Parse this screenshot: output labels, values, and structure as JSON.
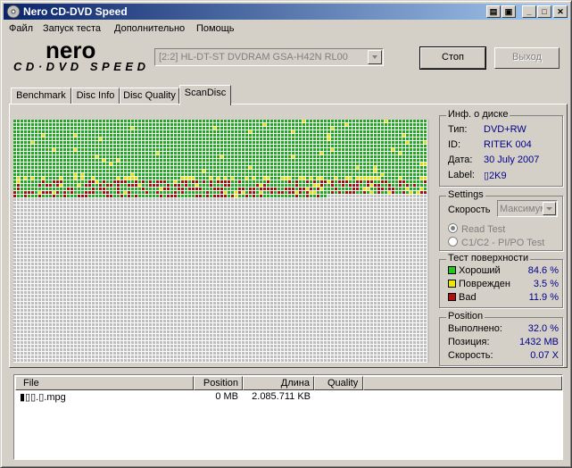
{
  "window": {
    "title": "Nero CD-DVD Speed",
    "controls": [
      "book-icon",
      "save-icon",
      "minimize",
      "maximize",
      "close"
    ],
    "title_color_start": "#0a246a",
    "title_color_end": "#a6caf0"
  },
  "menu": [
    "Файл",
    "Запуск теста",
    "Дополнительно",
    "Помощь"
  ],
  "logo": {
    "brand": "nero",
    "product": "CD·DVD SPEED"
  },
  "drive": {
    "selected": "[2:2]  HL-DT-ST DVDRAM GSA-H42N RL00"
  },
  "buttons": {
    "stop": "Стоп",
    "exit": "Выход"
  },
  "tabs": [
    "Benchmark",
    "Disc Info",
    "Disc Quality",
    "ScanDisc"
  ],
  "active_tab": "ScanDisc",
  "scan_map": {
    "colors": {
      "good": "#22a822",
      "damaged": "#e0e000",
      "bad": "#a01010",
      "empty": "#bfbfbf",
      "grid": "#ffffff"
    },
    "scanned_percent": 32.0
  },
  "disc_info": {
    "title": "Инф. о диске",
    "type_label": "Тип:",
    "type_value": "DVD+RW",
    "id_label": "ID:",
    "id_value": "RITEK 004",
    "date_label": "Дата:",
    "date_value": "30 July 2007",
    "label_label": "Label:",
    "label_value": "▯2K9"
  },
  "settings": {
    "title": "Settings",
    "speed_label": "Скорость",
    "speed_value": "Максимум",
    "options": [
      "Read Test",
      "C1/C2 - PI/PO Test"
    ],
    "selected_option": 0
  },
  "surface": {
    "title": "Тест поверхности",
    "items": [
      {
        "label": "Хороший",
        "value": "84.6 %",
        "color": "#22c822"
      },
      {
        "label": "Поврежден",
        "value": "3.5 %",
        "color": "#e8e800"
      },
      {
        "label": "Bad",
        "value": "11.9 %",
        "color": "#b01010"
      }
    ]
  },
  "position": {
    "title": "Position",
    "done_label": "Выполнено:",
    "done_value": "32.0 %",
    "pos_label": "Позиция:",
    "pos_value": "1432 MB",
    "speed_label": "Скорость:",
    "speed_value": "0.07 X"
  },
  "file_list": {
    "columns": [
      "File",
      "Position",
      "Длина",
      "Quality"
    ],
    "rows": [
      {
        "file": "▮▯▯.▯.mpg",
        "position": "0 MB",
        "length": "2.085.711 KB",
        "quality": ""
      }
    ]
  }
}
